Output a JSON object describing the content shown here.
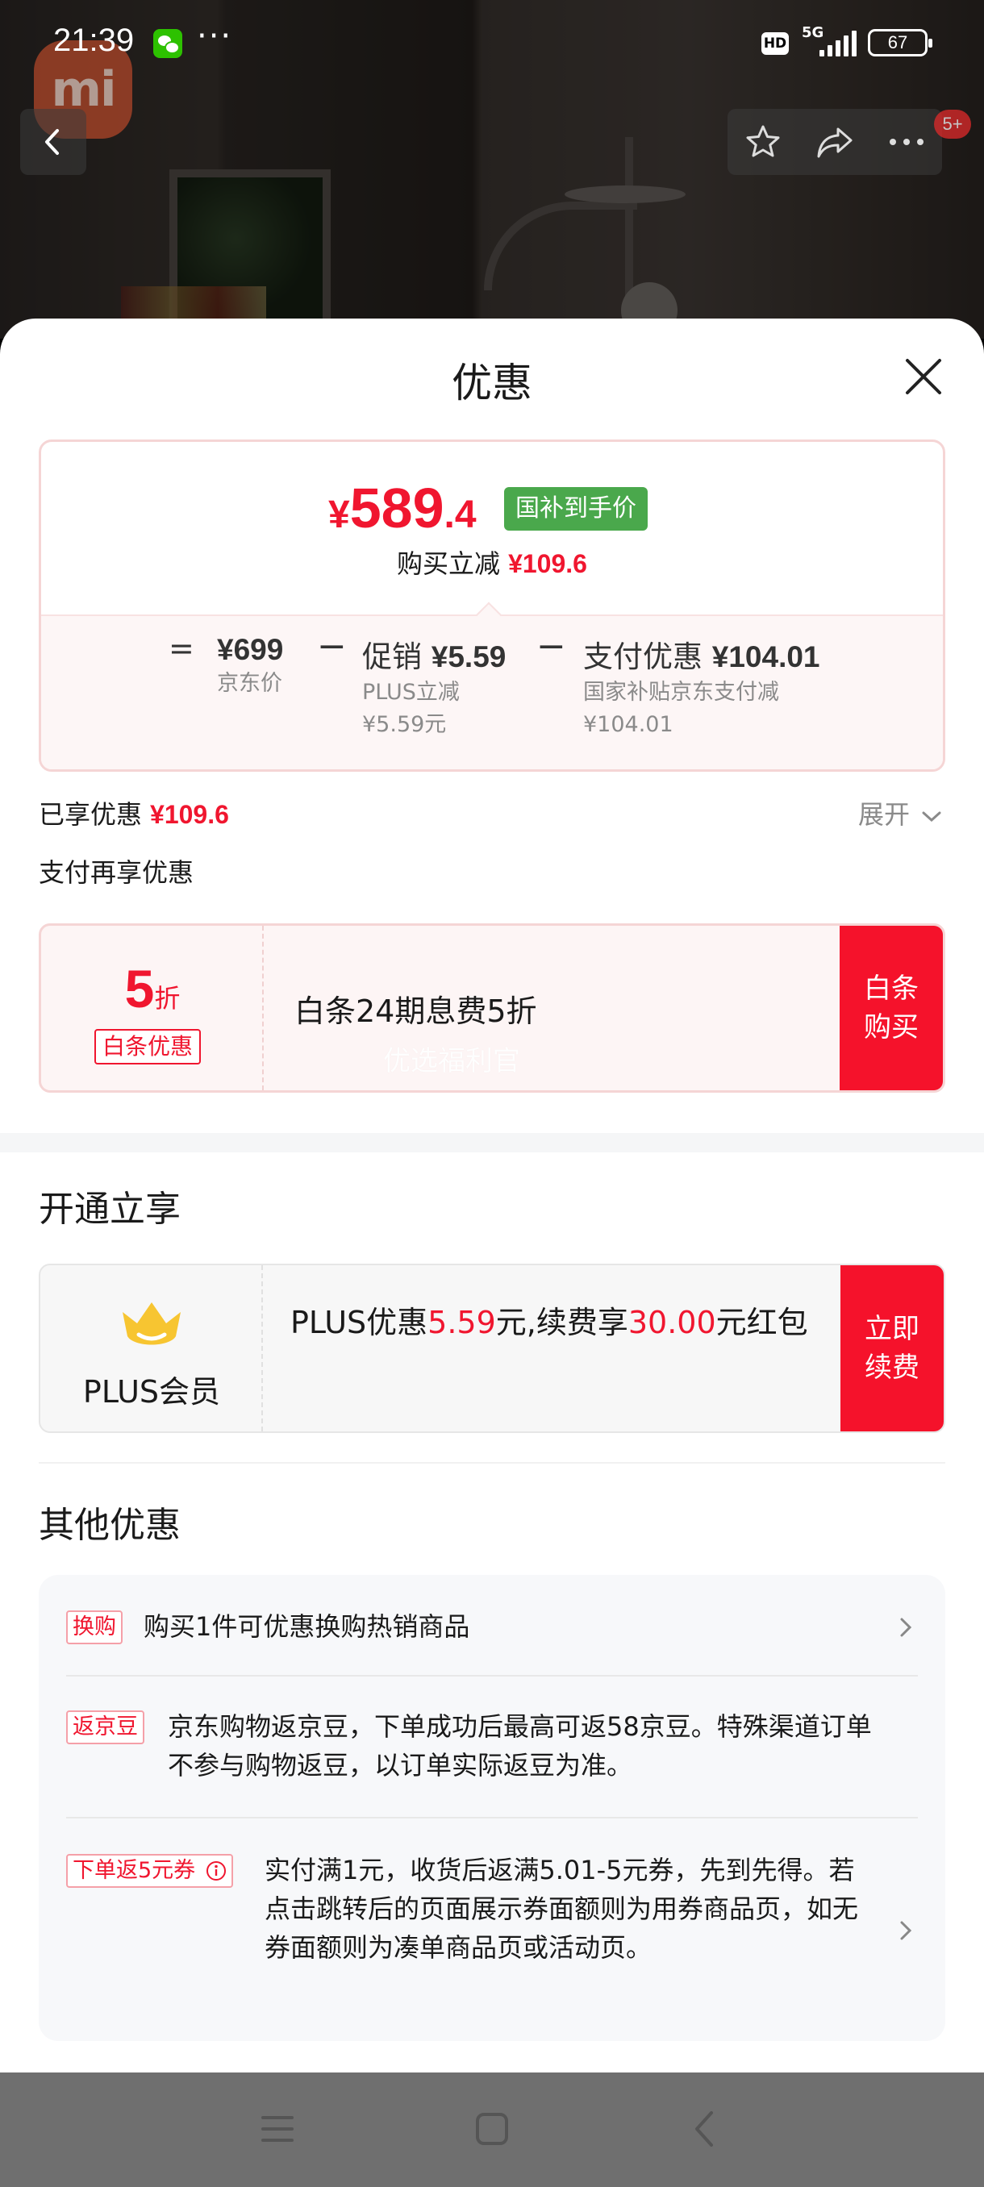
{
  "status_bar": {
    "time": "21:39",
    "dots": "···",
    "hd": "HD",
    "network": "5G",
    "battery": "67"
  },
  "brand_logo": "mi",
  "nav_badge": "5+",
  "sheet": {
    "title": "优惠",
    "price_card": {
      "final_price_currency": "¥",
      "final_price_int": "589",
      "final_price_dec": ".4",
      "badge": "国补到手价",
      "reduce_label": "购买立减",
      "reduce_amount": "¥109.6",
      "eq": "=",
      "items": [
        {
          "main_prefix": "",
          "main_amount": "¥699",
          "sub1": "京东价",
          "sub2": ""
        },
        {
          "main_prefix": "促销",
          "main_amount": "¥5.59",
          "sub1": "PLUS立减",
          "sub2": "¥5.59元"
        },
        {
          "main_prefix": "支付优惠",
          "main_amount": "¥104.01",
          "sub1": "国家补贴京东支付减",
          "sub2": "¥104.01"
        }
      ],
      "minus": "−"
    },
    "enjoyed_label": "已享优惠",
    "enjoyed_amount": "¥109.6",
    "expand_label": "展开",
    "pay_more_label": "支付再享优惠",
    "baitiao": {
      "discount_num": "5",
      "discount_unit": "折",
      "tag": "白条优惠",
      "text": "白条24期息费5折",
      "watermark": "优选福利官",
      "button_line1": "白条",
      "button_line2": "购买"
    },
    "open_title": "开通立享",
    "plus": {
      "label": "PLUS会员",
      "text_a": "PLUS优惠",
      "amount_a": "5.59",
      "text_b": "元,续费享",
      "amount_b": "30.00",
      "text_c": "元红包",
      "button_line1": "立即",
      "button_line2": "续费",
      "crown_color": "#f7c531"
    },
    "other_title": "其他优惠",
    "other_items": [
      {
        "tag": "换购",
        "text": "购买1件可优惠换购热销商品"
      },
      {
        "tag": "返京豆",
        "text": "京东购物返京豆，下单成功后最高可返58京豆。特殊渠道订单不参与购物返豆，以订单实际返豆为准。"
      },
      {
        "tag": "下单返5元券",
        "text": "实付满1元，收货后返满5.01-5元券，先到先得。若点击跳转后的页面展示券面额则为用券商品页，如无券面额则为凑单商品页或活动页。"
      }
    ]
  },
  "colors": {
    "accent_red": "#f0162f",
    "badge_green": "#4aa84c",
    "button_red": "#f5122b"
  }
}
